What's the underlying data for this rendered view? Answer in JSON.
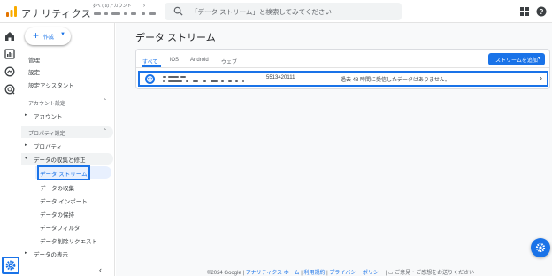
{
  "header": {
    "app_title": "アナリティクス",
    "account_label": "すべてのアカウント",
    "search_placeholder": "「データ ストリーム」と検索してみてください",
    "logo_icon": "analytics-logo-icon",
    "apps_icon": "apps-grid-icon",
    "help_icon": "help-icon"
  },
  "rail": {
    "items": [
      {
        "icon": "home-icon"
      },
      {
        "icon": "reports-icon"
      },
      {
        "icon": "explore-icon"
      },
      {
        "icon": "advertising-icon"
      }
    ],
    "settings_icon": "gear-icon"
  },
  "sidebar": {
    "create_label": "作成",
    "items": {
      "admin": "管理",
      "settings": "設定",
      "setup_assistant": "設定アシスタント",
      "account_settings": "アカウント設定",
      "account": "アカウント",
      "property_settings": "プロパティ設定",
      "property": "プロパティ",
      "data_collection": "データの収集と修正",
      "data_streams": "データ ストリーム",
      "data_collection_sub": "データの収集",
      "data_import": "データ インポート",
      "data_retention": "データの保持",
      "data_filters": "データフィルタ",
      "data_deletion": "データ削除リクエスト",
      "data_display": "データの表示"
    },
    "collapse_icon": "chevron-left-icon"
  },
  "main": {
    "title": "データ ストリーム",
    "tabs": [
      "すべて",
      "iOS",
      "Android",
      "ウェブ"
    ],
    "active_tab": "すべて",
    "add_stream_label": "ストリームを追加",
    "stream": {
      "id": "5513420111",
      "status": "過去 48 時間に受信したデータはありません。",
      "icon": "web-globe-icon"
    }
  },
  "footer": {
    "copyright": "©2024 Google",
    "home_link": "アナリティクス ホーム",
    "terms_link": "利用規約",
    "privacy_link": "プライバシー ポリシー",
    "feedback": "ご意見・ご感想をお送りください",
    "feedback_icon": "feedback-icon"
  },
  "fab_icon": "settings-assistant-icon",
  "colors": {
    "accent": "#1a73e8",
    "logo_orange": "#f9ab00",
    "logo_dark_orange": "#e37400"
  }
}
